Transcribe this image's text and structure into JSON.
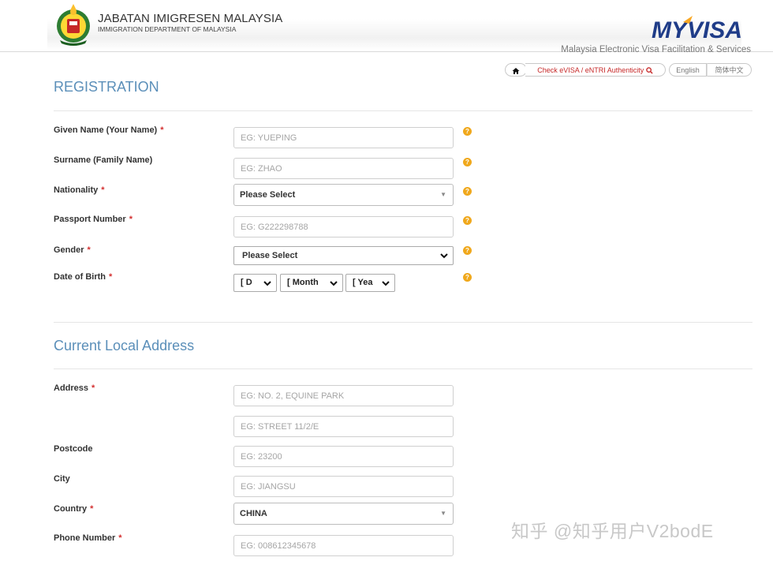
{
  "header": {
    "org_name": "JABATAN IMIGRESEN MALAYSIA",
    "org_sub": "IMMIGRATION DEPARTMENT OF MALAYSIA",
    "logo_text": "MYVISA",
    "tagline": "Malaysia Electronic Visa Facilitation & Services"
  },
  "topnav": {
    "home_icon": "home-icon",
    "check_label": "Check eVISA / eNTRI Authenticity",
    "check_icon": "search-icon",
    "lang_en": "English",
    "lang_cn": "简体中文"
  },
  "registration": {
    "title": "REGISTRATION",
    "given_name": {
      "label": "Given Name (Your Name)",
      "required": "*",
      "placeholder": "EG: YUEPING"
    },
    "surname": {
      "label": "Surname (Family Name)",
      "placeholder": "EG: ZHAO"
    },
    "nationality": {
      "label": "Nationality",
      "required": "*",
      "value": "Please Select"
    },
    "passport": {
      "label": "Passport Number",
      "required": "*",
      "placeholder": "EG: G222298788"
    },
    "gender": {
      "label": "Gender",
      "required": "*",
      "value": "Please Select"
    },
    "dob": {
      "label": "Date of Birth",
      "required": "*",
      "day": "[ D",
      "month": "[ Month",
      "year": "[ Yea"
    },
    "help_glyph": "?"
  },
  "address": {
    "title": "Current Local Address",
    "address": {
      "label": "Address",
      "required": "*",
      "placeholder1": "EG: NO. 2, EQUINE PARK",
      "placeholder2": "EG: STREET 11/2/E"
    },
    "postcode": {
      "label": "Postcode",
      "placeholder": "EG: 23200"
    },
    "city": {
      "label": "City",
      "placeholder": "EG: JIANGSU"
    },
    "country": {
      "label": "Country",
      "required": "*",
      "value": "CHINA"
    },
    "phone": {
      "label": "Phone Number",
      "required": "*",
      "placeholder": "EG: 008612345678"
    }
  },
  "watermark": "知乎 @知乎用户V2bodE",
  "colors": {
    "section_title": "#5b8fb9",
    "required": "#d32f2f",
    "help_icon": "#f0a81c",
    "check_link": "#c62828"
  }
}
